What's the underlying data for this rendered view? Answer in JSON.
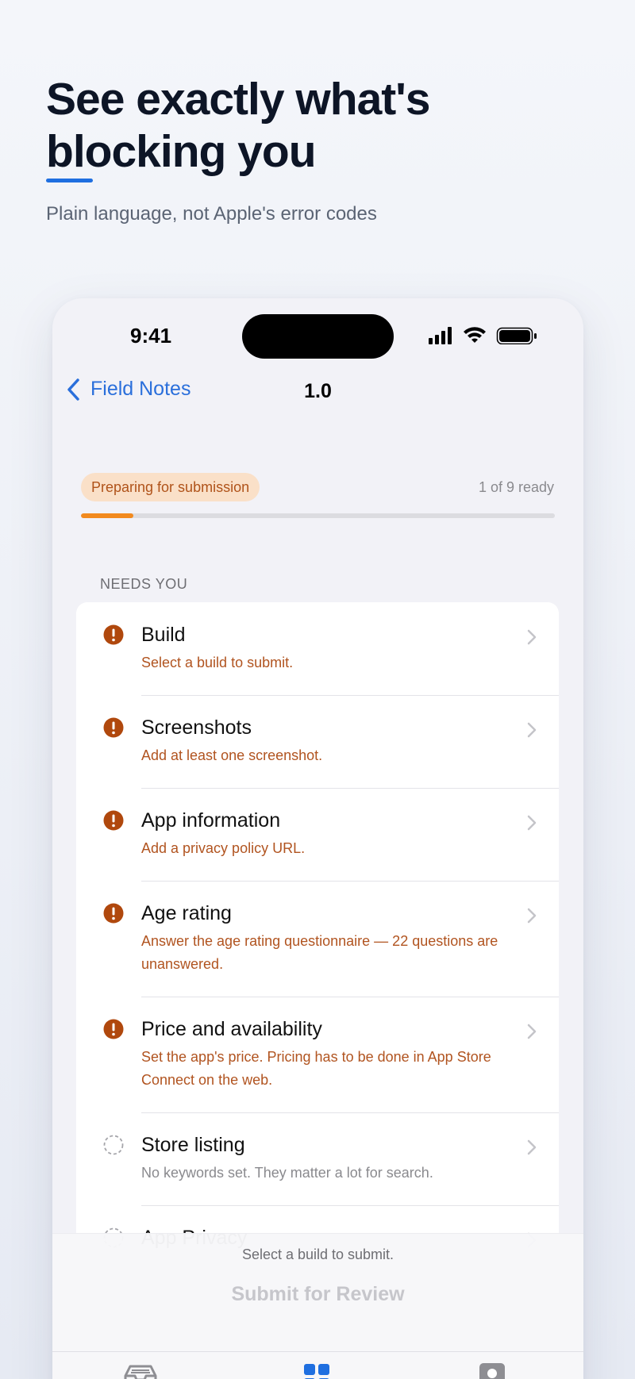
{
  "marketing": {
    "headline": "See exactly what's blocking you",
    "subhead": "Plain language, not Apple's error codes"
  },
  "status_bar": {
    "time": "9:41"
  },
  "nav": {
    "back_label": "Field Notes",
    "title": "1.0"
  },
  "submission": {
    "status_badge": "Preparing for submission",
    "ready_text": "1 of 9 ready",
    "progress_fraction": 0.111,
    "accent_color": "#f28a1e"
  },
  "section": {
    "header": "NEEDS YOU"
  },
  "items": [
    {
      "title": "Build",
      "subtitle": "Select a build to submit.",
      "state": "error"
    },
    {
      "title": "Screenshots",
      "subtitle": "Add at least one screenshot.",
      "state": "error"
    },
    {
      "title": "App information",
      "subtitle": "Add a privacy policy URL.",
      "state": "error"
    },
    {
      "title": "Age rating",
      "subtitle": "Answer the age rating questionnaire — 22 questions are unanswered.",
      "state": "error"
    },
    {
      "title": "Price and availability",
      "subtitle": "Set the app's price. Pricing has to be done in App Store Connect on the web.",
      "state": "error"
    },
    {
      "title": "Store listing",
      "subtitle": "No keywords set. They matter a lot for search.",
      "state": "pending"
    },
    {
      "title": "App Privacy",
      "subtitle": "",
      "state": "pending"
    }
  ],
  "footer": {
    "hint": "Select a build to submit.",
    "submit_label": "Submit for Review"
  },
  "colors": {
    "link": "#2a6fdb",
    "warning": "#b0531a",
    "tab_active": "#1f6fe0"
  },
  "icons": {
    "error": "exclamation-circle-icon",
    "pending": "dashed-circle-icon",
    "tabs": [
      "tray-icon",
      "grid-icon",
      "person-icon"
    ]
  }
}
